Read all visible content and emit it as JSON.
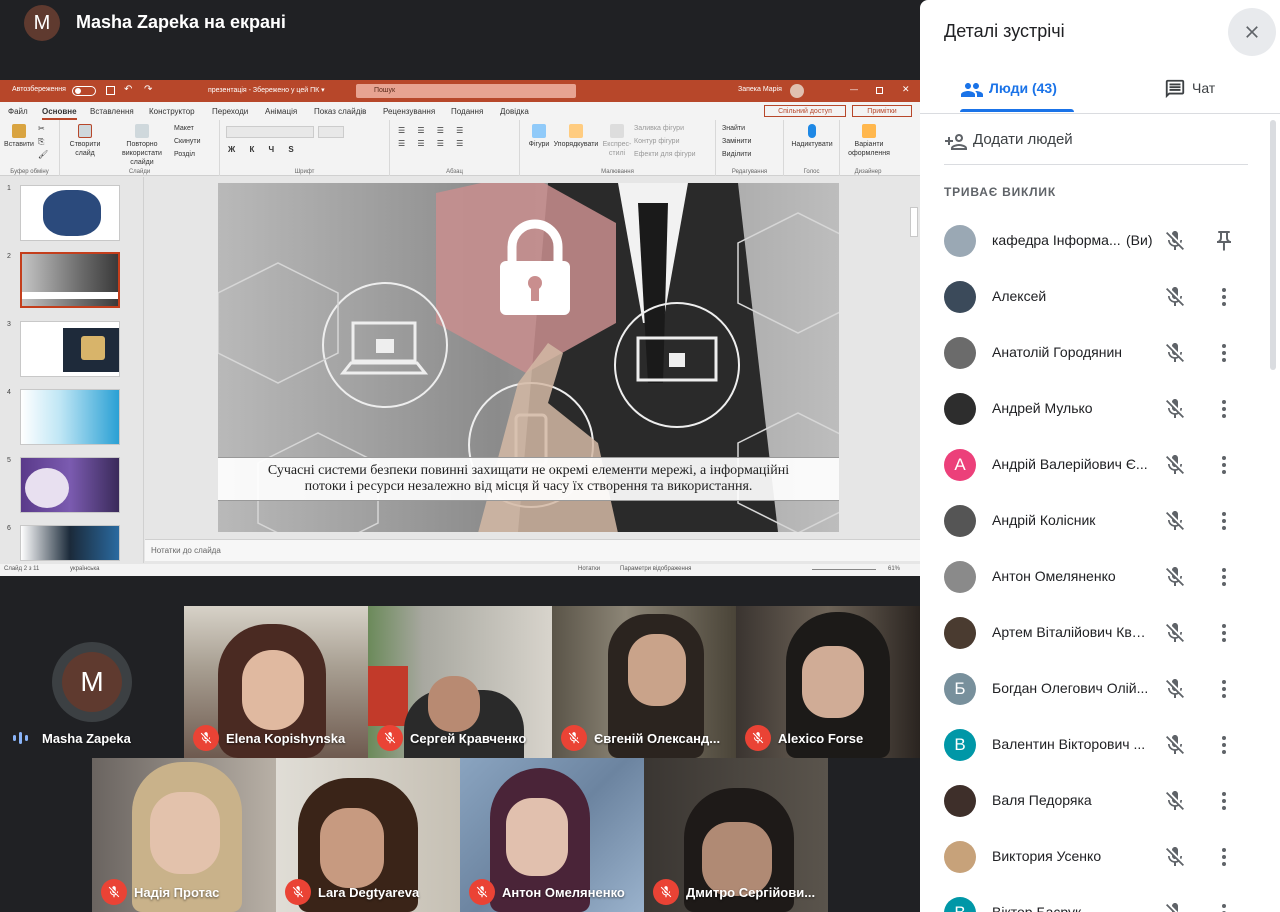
{
  "presenter": {
    "avatar_letter": "M",
    "title": "Masha Zapeka на екрані"
  },
  "ppt": {
    "autosave": "Автозбереження",
    "doc_title": "презентація - Збережено у цей ПК ▾",
    "search_placeholder": "Пошук",
    "user": "Запека Марія",
    "menu": [
      "Файл",
      "Основне",
      "Вставлення",
      "Конструктор",
      "Переходи",
      "Анімація",
      "Показ слайдів",
      "Рецензування",
      "Подання",
      "Довідка"
    ],
    "share": "Спільний доступ",
    "notes_btn": "Примітки",
    "ribbon": {
      "paste": "Вставити",
      "create_slide": "Створити слайд",
      "reuse": "Повторно використати слайди",
      "layout": "Макет",
      "reset": "Скинути",
      "sections": "Розділ",
      "clipboard": "Буфер обміну",
      "slides": "Слайди",
      "font": "Шрифт",
      "paragraph": "Абзац",
      "shapes": "Фігури",
      "arrange": "Упорядкувати",
      "quick_styles": "Експрес-стилі",
      "fill": "Заливка фігури",
      "outline": "Контур фігури",
      "effects": "Ефекти для фігури",
      "drawing": "Малювання",
      "find": "Знайти",
      "replace": "Замінити",
      "select": "Виділити",
      "editing": "Редагування",
      "dictate": "Надиктувати",
      "voice": "Голос",
      "designer_ideas": "Варіанти оформлення",
      "designer": "Дизайнер"
    },
    "thumb_numbers": [
      "1",
      "2",
      "3",
      "4",
      "5",
      "6"
    ],
    "slide_caption_1": "Сучасні системи безпеки повинні захищати не окремі елементи мережі, а інформаційні",
    "slide_caption_2": "потоки і ресурси незалежно від місця й часу їх створення та використання.",
    "notes_placeholder": "Нотатки до слайда",
    "status": {
      "slide_of": "Слайд 2 з 11",
      "language": "українська",
      "notes": "Нотатки",
      "display": "Параметри відображення",
      "zoom": "61%"
    }
  },
  "tiles_row1": [
    {
      "name": "Masha Zapeka",
      "avatar": "M",
      "speaking": true
    },
    {
      "name": "Elena Kopishynska"
    },
    {
      "name": "Сергей Кравченко"
    },
    {
      "name": "Євгеній Олександ..."
    },
    {
      "name": "Alexico Forse"
    }
  ],
  "tiles_row2": [
    {
      "name": "Надія Протас"
    },
    {
      "name": "Lara Degtyareva"
    },
    {
      "name": "Антон Омеляненко"
    },
    {
      "name": "Дмитро Сергійови..."
    }
  ],
  "panel": {
    "title": "Деталі зустрічі",
    "tab_people": "Люди (43)",
    "tab_chat": "Чат",
    "add_people": "Додати людей",
    "section": "ТРИВАЄ ВИКЛИК",
    "people": [
      {
        "name": "кафедра Інформа...",
        "you": "(Ви)",
        "avatar_color": "#9aa8b4",
        "letter": ""
      },
      {
        "name": "Алексей",
        "avatar_color": "#3b4a5a",
        "letter": ""
      },
      {
        "name": "Анатолій Городянин",
        "avatar_color": "#6b6b6b",
        "letter": ""
      },
      {
        "name": "Андрей Мулько",
        "avatar_color": "#2d2d2d",
        "letter": ""
      },
      {
        "name": "Андрій Валерійович Є...",
        "avatar_color": "#ec407a",
        "letter": "А"
      },
      {
        "name": "Андрій Колісник",
        "avatar_color": "#555555",
        "letter": ""
      },
      {
        "name": "Антон Омеляненко",
        "avatar_color": "#8a8a8a",
        "letter": ""
      },
      {
        "name": "Артем Віталійович Ква...",
        "avatar_color": "#4a3b30",
        "letter": ""
      },
      {
        "name": "Богдан Олегович Олій...",
        "avatar_color": "#78909c",
        "letter": "Б"
      },
      {
        "name": "Валентин Вікторович ...",
        "avatar_color": "#0097a7",
        "letter": "В"
      },
      {
        "name": "Валя Педоряка",
        "avatar_color": "#3e2f2a",
        "letter": ""
      },
      {
        "name": "Виктория Усенко",
        "avatar_color": "#c7a27a",
        "letter": ""
      },
      {
        "name": "Віктор Басрук",
        "avatar_color": "#0097a7",
        "letter": "В"
      }
    ]
  }
}
